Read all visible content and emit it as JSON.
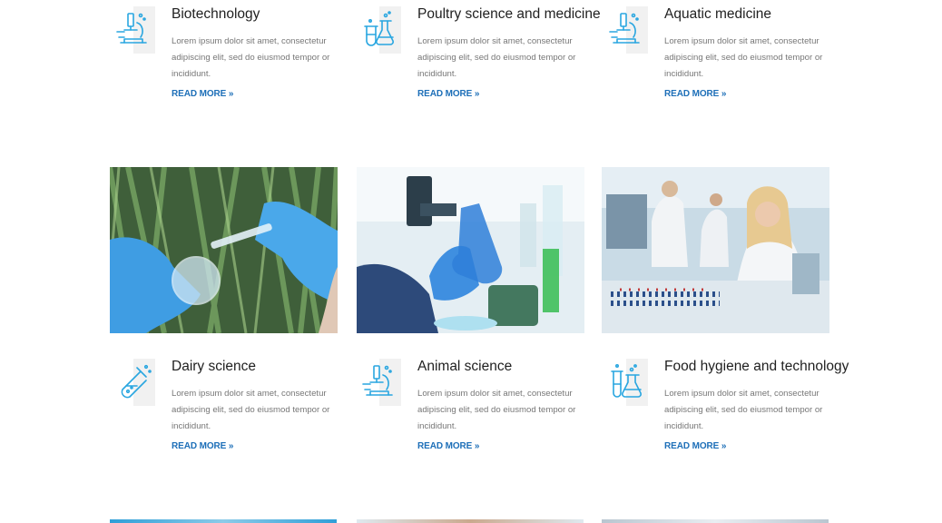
{
  "colors": {
    "accent": "#1d6fb8",
    "icon": "#29a6e0",
    "text_muted": "#777777"
  },
  "services": [
    {
      "title": "Biotechnology",
      "icon": "microscope-icon",
      "description": "Lorem ipsum dolor sit amet, consectetur adipiscing elit, sed do eiusmod tempor or incididunt.",
      "link": "READ MORE »"
    },
    {
      "title": "Poultry science and medicine",
      "icon": "flasks-icon",
      "description": "Lorem ipsum dolor sit amet, consectetur adipiscing elit, sed do eiusmod tempor or incididunt.",
      "link": "READ MORE »"
    },
    {
      "title": "Aquatic medicine",
      "icon": "microscope-icon",
      "description": "Lorem ipsum dolor sit amet, consectetur adipiscing elit, sed do eiusmod tempor or incididunt.",
      "link": "READ MORE »"
    },
    {
      "title": "Dairy science",
      "icon": "test-tube-icon",
      "description": "Lorem ipsum dolor sit amet, consectetur adipiscing elit, sed do eiusmod tempor or incididunt.",
      "link": "READ MORE »"
    },
    {
      "title": "Animal science",
      "icon": "microscope-icon",
      "description": "Lorem ipsum dolor sit amet, consectetur adipiscing elit, sed do eiusmod tempor or incididunt.",
      "link": "READ MORE »"
    },
    {
      "title": "Food hygiene and technology",
      "icon": "lab-glassware-icon",
      "description": "Lorem ipsum dolor sit amet, consectetur adipiscing elit, sed do eiusmod tempor or incididunt.",
      "link": "READ MORE »"
    }
  ],
  "photos": [
    {
      "subject": "gloved hands holding flask and test tube outdoors"
    },
    {
      "subject": "gloved hand holding blue flask in lab"
    },
    {
      "subject": "scientists working in laboratory"
    }
  ]
}
